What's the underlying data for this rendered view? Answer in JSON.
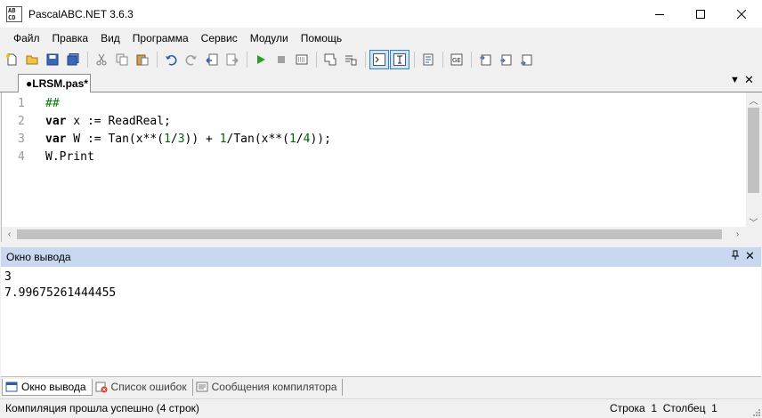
{
  "window": {
    "title": "PascalABC.NET 3.6.3",
    "app_icon_text": "AB\nCD"
  },
  "menu": {
    "items": [
      "Файл",
      "Правка",
      "Вид",
      "Программа",
      "Сервис",
      "Модули",
      "Помощь"
    ]
  },
  "toolbar": {
    "icons": [
      "new-file-icon",
      "open-folder-icon",
      "save-icon",
      "save-all-icon",
      "cut-icon",
      "copy-icon",
      "paste-icon",
      "undo-icon",
      "redo-icon",
      "navigate-back-icon",
      "navigate-forward-icon",
      "run-icon",
      "stop-icon",
      "debug-icon",
      "output-window-icon",
      "output-window-alt-icon",
      "console-icon",
      "text-mode-icon",
      "format-icon",
      "form-designer-icon",
      "step-into-icon",
      "step-over-icon",
      "step-out-icon"
    ]
  },
  "editor": {
    "tab_label": "●LRSM.pas*",
    "line_numbers": [
      "1",
      "2",
      "3",
      "4"
    ],
    "lines": [
      "##",
      "var x := ReadReal;",
      "var W := Tan(x**(1/3)) + 1/Tan(x**(1/4));",
      "W.Print"
    ]
  },
  "output": {
    "title": "Окно вывода",
    "lines": [
      "3",
      "7.99675261444455"
    ]
  },
  "bottom_tabs": [
    {
      "label": "Окно вывода",
      "icon": "output-window-icon",
      "active": true
    },
    {
      "label": "Список ошибок",
      "icon": "error-list-icon",
      "active": false
    },
    {
      "label": "Сообщения компилятора",
      "icon": "compiler-messages-icon",
      "active": false
    }
  ],
  "status": {
    "message": "Компиляция прошла успешно (4 строк)",
    "row_label": "Строка",
    "row_value": "1",
    "col_label": "Столбец",
    "col_value": "1"
  },
  "colors": {
    "output_header_bg": "#c8d8f0",
    "number_color": "#006400",
    "comment_color": "#008000",
    "run_green": "#2e9a2e",
    "active_toolbar_border": "#3c7fb1"
  }
}
